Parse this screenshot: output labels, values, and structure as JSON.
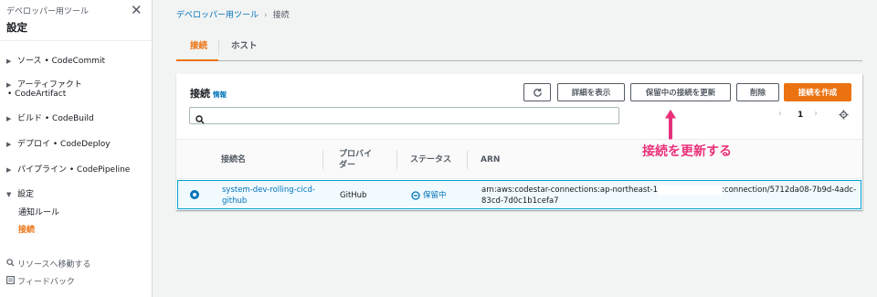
{
  "sidebar": {
    "subtitle": "デベロッパー用ツール",
    "title": "設定",
    "close_icon": "close-icon",
    "items": [
      {
        "label": "ソース",
        "service": "• CodeCommit"
      },
      {
        "label": "アーティファクト",
        "service": "• CodeArtifact"
      },
      {
        "label": "ビルド",
        "service": "• CodeBuild"
      },
      {
        "label": "デプロイ",
        "service": "• CodeDeploy"
      },
      {
        "label": "パイプライン",
        "service": "• CodePipeline"
      },
      {
        "label": "設定",
        "service": ""
      }
    ],
    "sub_items": [
      "通知ルール",
      "接続"
    ],
    "footer": [
      "リソースへ移動する",
      "フィードバック"
    ]
  },
  "breadcrumb": {
    "parent": "デベロッパー用ツール",
    "current": "接続"
  },
  "tabs": [
    "接続",
    "ホスト"
  ],
  "panel": {
    "title": "接続",
    "info": "情報",
    "buttons": {
      "refresh_icon": "refresh-icon",
      "details": "詳細を表示",
      "update_pending": "保留中の接続を更新",
      "delete": "削除",
      "create": "接続を作成"
    },
    "search_placeholder": "",
    "pager": {
      "page": "1"
    }
  },
  "table": {
    "columns": [
      "接続名",
      "プロバイダー",
      "ステータス",
      "ARN"
    ],
    "rows": [
      {
        "name_line1": "system-dev-rolling-cicd-",
        "name_line2": "github",
        "provider": "GitHub",
        "status": "保留中",
        "arn_prefix": "arn:aws:codestar-connections:ap-northeast-1",
        "arn_suffix": ":connection/5712da08-7b9d-4adc-",
        "arn_line2": "83cd-7d0c1b1cefa7"
      }
    ]
  },
  "annotation": {
    "text": "接続を更新する",
    "color": "#e8317a"
  },
  "colors": {
    "accent": "#ec7211",
    "link": "#0073bb",
    "selected_row": "#f1faff"
  }
}
